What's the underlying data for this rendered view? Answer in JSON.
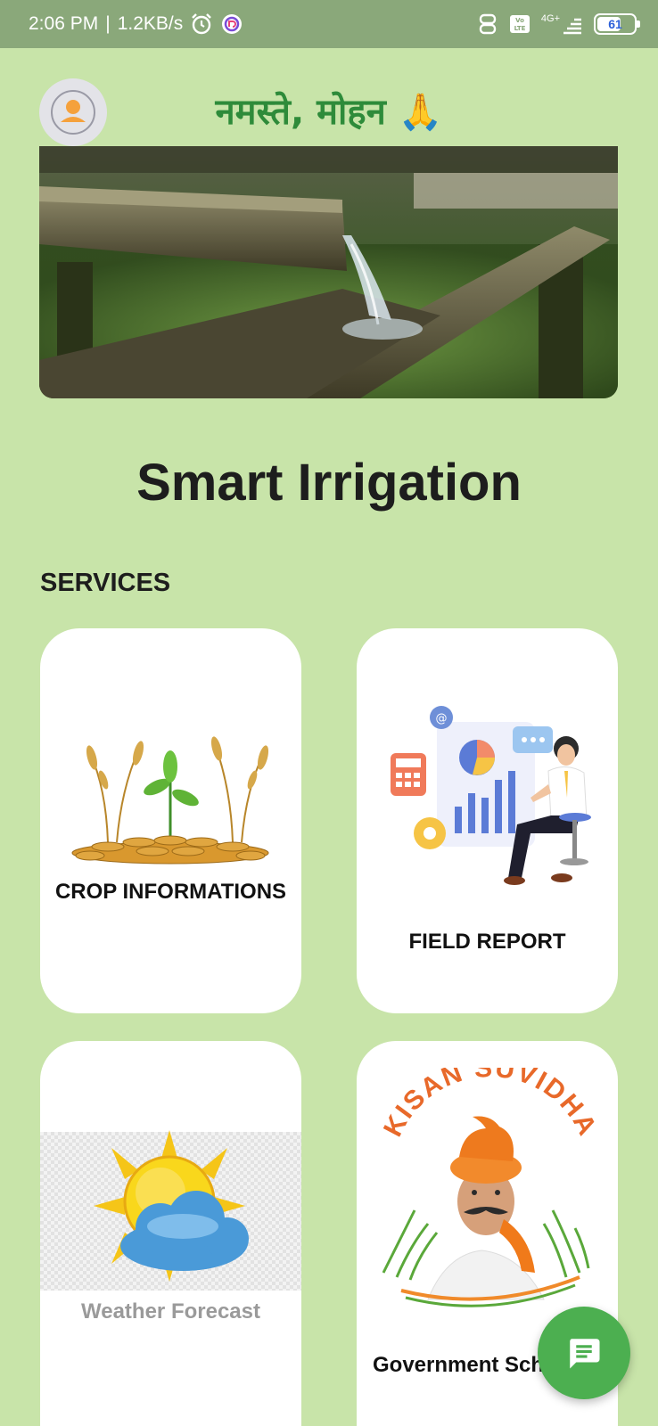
{
  "status_bar": {
    "time": "2:06 PM",
    "separator": "|",
    "network_speed": "1.2KB/s",
    "network_type": "4G+",
    "battery_level": "61"
  },
  "header": {
    "greeting": "नमस्ते, मोहन 🙏",
    "avatar_icon": "person-icon"
  },
  "app": {
    "title": "Smart Irrigation"
  },
  "services": {
    "heading": "SERVICES",
    "items": [
      {
        "label": "CROP INFORMATIONS",
        "icon": "crop-coins-icon"
      },
      {
        "label": "FIELD REPORT",
        "icon": "report-chart-icon"
      },
      {
        "label": "Weather Forecast",
        "icon": "sun-cloud-icon"
      },
      {
        "label": "Government Sch",
        "icon": "kisan-suvidha-logo"
      }
    ]
  },
  "logo_text": "KISAN SUVIDHA",
  "colors": {
    "background": "#c8e4a9",
    "greeting": "#2e8b3a",
    "fab": "#4caf50",
    "status_bar": "#8aa87a"
  },
  "fab": {
    "icon": "chat-icon"
  }
}
